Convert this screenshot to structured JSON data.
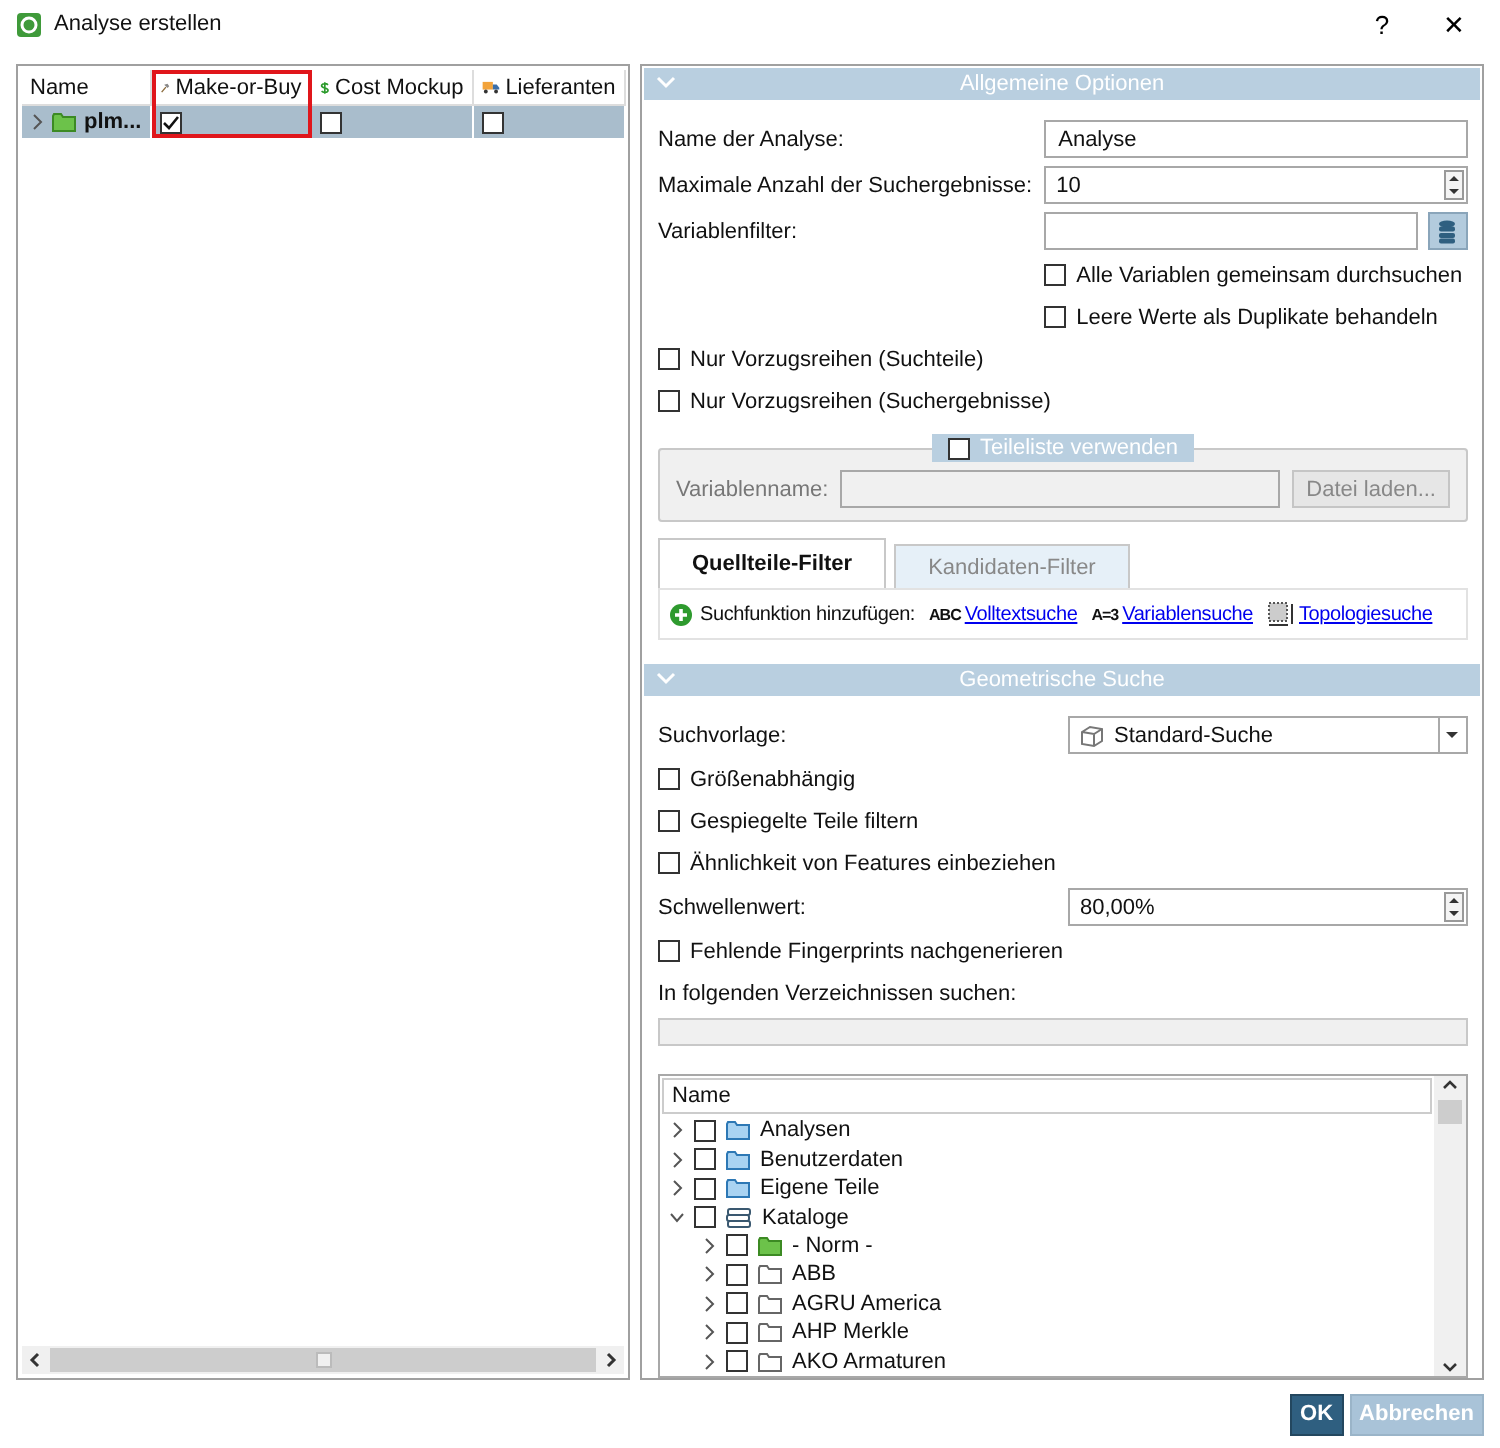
{
  "window": {
    "title": "Analyse erstellen",
    "help": "?",
    "close": "✕"
  },
  "left_table": {
    "columns": [
      {
        "label": "Name",
        "kind": "name",
        "highlighted": false
      },
      {
        "label": "Make-or-Buy",
        "kind": "hammer",
        "highlighted": true
      },
      {
        "label": "Cost Mockup",
        "kind": "dollar",
        "highlighted": false
      },
      {
        "label": "Lieferanten",
        "kind": "truck",
        "highlighted": false
      }
    ],
    "rows": [
      {
        "name": "plm...",
        "selected": true,
        "expanded": false,
        "checks": [
          true,
          false,
          false
        ]
      }
    ]
  },
  "general_options": {
    "title": "Allgemeine Optionen",
    "expanded": true,
    "name_label": "Name der Analyse:",
    "name_value": "Analyse",
    "max_label": "Maximale Anzahl der Suchergebnisse:",
    "max_value": "10",
    "filter_label": "Variablenfilter:",
    "filter_checks": [
      {
        "label": "Alle Variablen gemeinsam durchsuchen",
        "checked": false
      },
      {
        "label": "Leere Werte als Duplikate behandeln",
        "checked": false
      }
    ],
    "checks": [
      {
        "label": "Nur Vorzugsreihen (Suchteile)",
        "checked": false
      },
      {
        "label": "Nur Vorzugsreihen (Suchergebnisse)",
        "checked": false
      }
    ],
    "partlist": {
      "label": "Teileliste verwenden",
      "checked": false,
      "field_label": "Variablenname:",
      "button": "Datei laden...",
      "disabled": true
    },
    "tabs": [
      {
        "label": "Quellteile-Filter",
        "selected": true
      },
      {
        "label": "Kandidaten-Filter",
        "selected": false
      }
    ],
    "add_label": "Suchfunktion hinzufügen:",
    "search_links": [
      {
        "kind": "text",
        "icon_text": "ABC",
        "label": "Volltextsuche"
      },
      {
        "kind": "variable",
        "icon_text": "A=3",
        "label": "Variablensuche"
      },
      {
        "kind": "topology",
        "label": "Topologiesuche"
      }
    ]
  },
  "geometric_search": {
    "title": "Geometrische Suche",
    "expanded": true,
    "template_label": "Suchvorlage:",
    "template_value": "Standard-Suche",
    "checks": [
      {
        "label": "Größenabhängig",
        "checked": false
      },
      {
        "label": "Gespiegelte Teile filtern",
        "checked": false
      },
      {
        "label": "Ähnlichkeit von Features einbeziehen",
        "checked": false
      }
    ],
    "threshold_label": "Schwellenwert:",
    "threshold_value": "80,00%",
    "regen": {
      "label": "Fehlende Fingerprints nachgenerieren",
      "checked": false
    },
    "dirs_label": "In folgenden Verzeichnissen suchen:",
    "tree_header": "Name",
    "tree": [
      {
        "label": "Analysen",
        "kind": "folder",
        "expanded": false,
        "checked": false
      },
      {
        "label": "Benutzerdaten",
        "kind": "folder",
        "expanded": false,
        "checked": false
      },
      {
        "label": "Eigene Teile",
        "kind": "folder",
        "expanded": false,
        "checked": false
      },
      {
        "label": "Kataloge",
        "kind": "catalogs",
        "expanded": true,
        "checked": false,
        "children": [
          {
            "label": "- Norm -",
            "kind": "norm",
            "expanded": false,
            "checked": false
          },
          {
            "label": "ABB",
            "kind": "catalog",
            "expanded": false,
            "checked": false
          },
          {
            "label": "AGRU America",
            "kind": "catalog",
            "expanded": false,
            "checked": false
          },
          {
            "label": "AHP Merkle",
            "kind": "catalog",
            "expanded": false,
            "checked": false
          },
          {
            "label": "AKO Armaturen",
            "kind": "catalog",
            "expanded": false,
            "checked": false
          }
        ]
      }
    ]
  },
  "buttons": [
    {
      "label": "OK",
      "kind": "primary"
    },
    {
      "label": "Abbrechen",
      "kind": "secondary"
    }
  ]
}
